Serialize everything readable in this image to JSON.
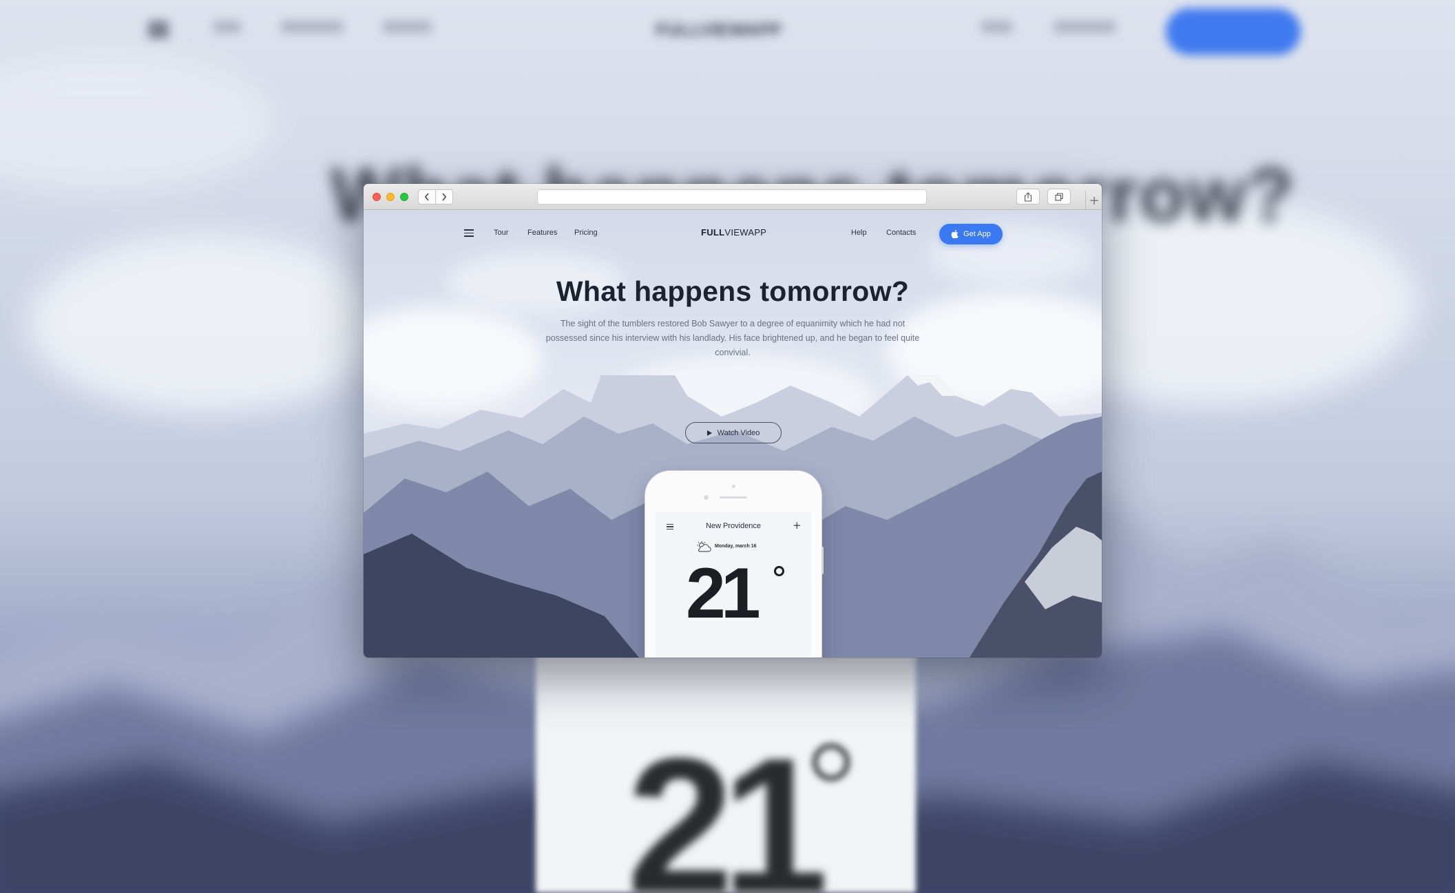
{
  "colors": {
    "accent": "#3b79f2",
    "heading": "#1e2130",
    "body_text": "#6c7083",
    "traffic_red": "#fc5f57",
    "traffic_yellow": "#fdbc2e",
    "traffic_green": "#28c840"
  },
  "browser": {
    "url": "",
    "icons": {
      "back": "chevron-left-icon",
      "forward": "chevron-right-icon",
      "share": "share-icon",
      "tabs": "tabs-icon",
      "new_tab": "plus-icon"
    }
  },
  "nav": {
    "menu_icon": "hamburger-icon",
    "links_left": [
      "Tour",
      "Features",
      "Pricing"
    ],
    "brand_bold": "FULL",
    "brand_rest": "VIEWAPP",
    "links_right": [
      "Help",
      "Contacts"
    ],
    "cta_icon": "apple-icon",
    "cta_label": "Get App"
  },
  "hero": {
    "headline": "What happens tomorrow?",
    "body": "The sight of the tumblers restored Bob Sawyer to a degree of equanimity which he had not possessed since his interview with his landlady. His face brightened up, and he began to feel quite convivial.",
    "watch_icon": "play-icon",
    "watch_label": "Watch Video"
  },
  "phone_app": {
    "menu_icon": "hamburger-icon",
    "city": "New Providence",
    "add_icon": "plus-icon",
    "weather_icon": "partly-cloudy-icon",
    "date": "Monday, march 16",
    "temperature": "21",
    "unit_icon": "degree-icon"
  },
  "background_blurred": {
    "brand": "FULLVIEWAPP",
    "headline": "What happens tomorrow?",
    "temperature": "21"
  }
}
